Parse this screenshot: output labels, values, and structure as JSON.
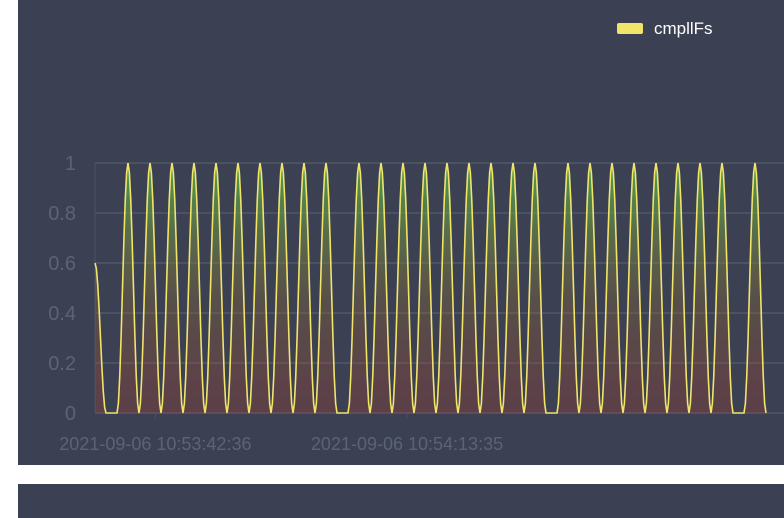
{
  "chart_data": {
    "type": "line",
    "title": "",
    "xlabel": "",
    "ylabel": "",
    "ylim": [
      0,
      1
    ],
    "yticks": [
      "0",
      "0.2",
      "0.4",
      "0.6",
      "0.8",
      "1"
    ],
    "xticks": [
      "2021-09-06 10:53:42:36",
      "2021-09-06 10:54:13:35"
    ],
    "grid": true,
    "legend_position": "top-right",
    "series": [
      {
        "name": "cmpllFs",
        "color": "#f2e469",
        "gradient_fill": true,
        "x_range_seconds": 60,
        "values": [
          0.6,
          0,
          0,
          1,
          0,
          1,
          0,
          1,
          0,
          1,
          0,
          1,
          0,
          1,
          0,
          1,
          0,
          1,
          0,
          1,
          0,
          1,
          0,
          0,
          1,
          0,
          1,
          0,
          1,
          0,
          1,
          0,
          1,
          0,
          1,
          0,
          1,
          0,
          1,
          0,
          1,
          0,
          0,
          1,
          0,
          1,
          0,
          1,
          0,
          1,
          0,
          1,
          0,
          1,
          0,
          1,
          0,
          1,
          0,
          0,
          1,
          0
        ]
      }
    ]
  },
  "colors": {
    "panel": "#3b4152",
    "grid": "#5b6377",
    "axis": "#4a5165",
    "line": "#f2e469"
  }
}
